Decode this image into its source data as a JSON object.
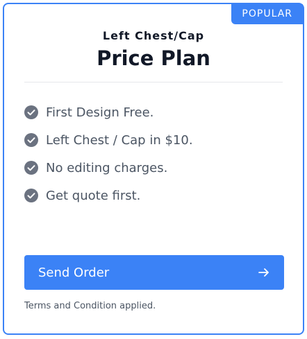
{
  "badge": "POPULAR",
  "card": {
    "subtitle": "Left Chest/Cap",
    "title": "Price Plan"
  },
  "features": [
    "First Design Free.",
    "Left Chest / Cap in $10.",
    "No editing charges.",
    "Get quote first."
  ],
  "button": {
    "label": "Send Order",
    "icon": "arrow-right-icon"
  },
  "terms": "Terms and Condition applied.",
  "colors": {
    "accent": "#3b82f6",
    "icon_gray": "#6b7280",
    "text_dark": "#111827",
    "text_muted": "#4b5563"
  }
}
